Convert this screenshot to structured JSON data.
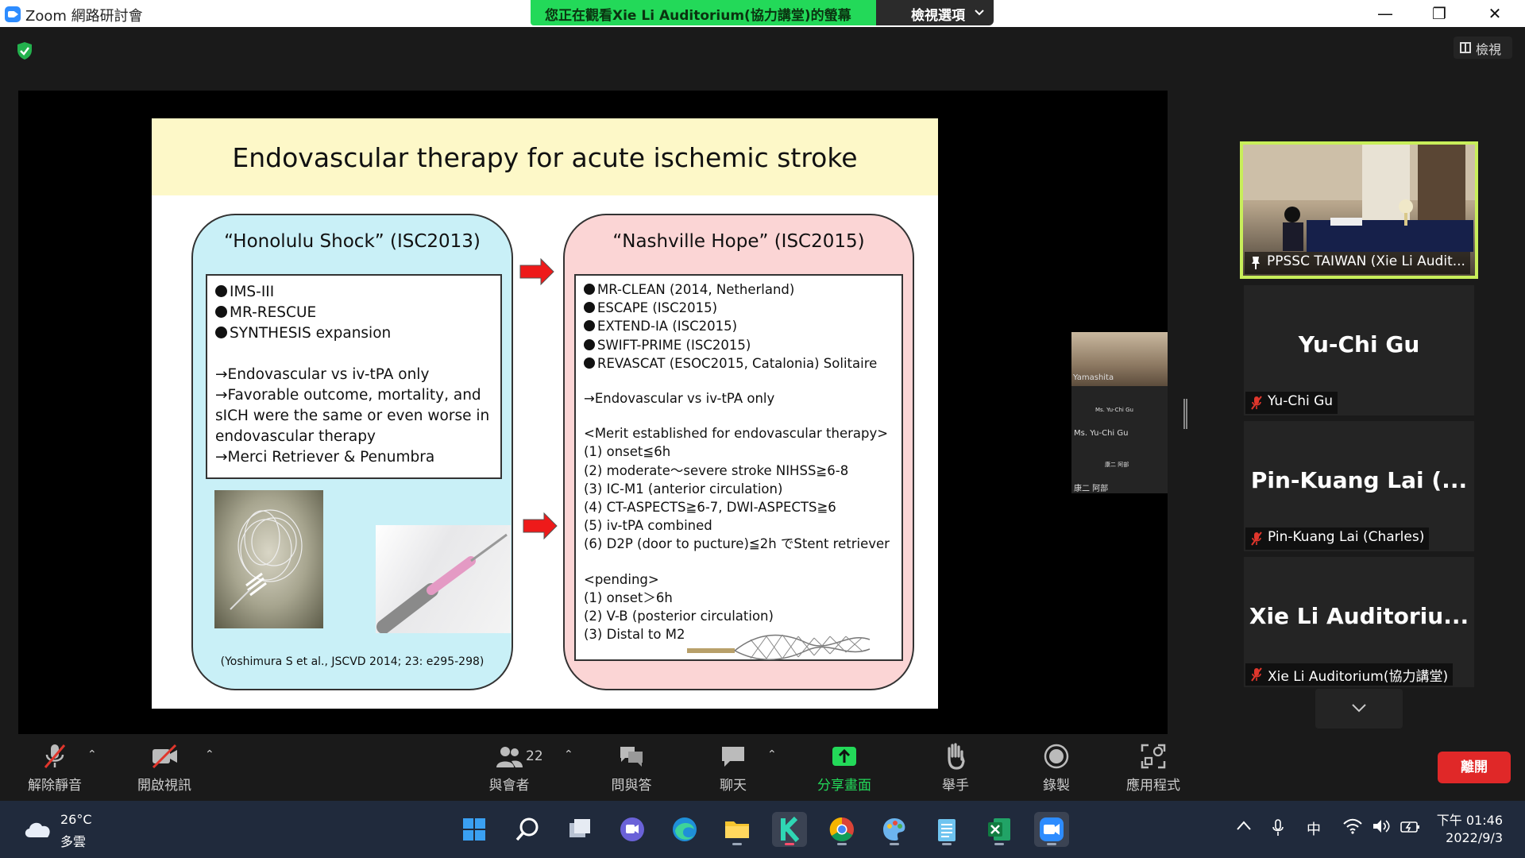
{
  "window": {
    "app_title": "Zoom 網路研討會",
    "viewing_banner": "您正在觀看Xie Li Auditorium(協力講堂)的螢幕",
    "view_options": "檢視選項",
    "minimize": "—",
    "restore": "❐",
    "close": "✕"
  },
  "meeting": {
    "view_button": "檢視"
  },
  "slide": {
    "title": "Endovascular therapy for acute ischemic stroke",
    "left": {
      "heading": "“Honolulu Shock” (ISC2013)",
      "trials": [
        "IMS-III",
        "MR-RESCUE",
        "SYNTHESIS expansion"
      ],
      "notes": [
        "→Endovascular vs iv-tPA only",
        "→Favorable outcome, mortality, and sICH were the same or even worse in endovascular therapy",
        "→Merci Retriever & Penumbra"
      ],
      "citation": "(Yoshimura S et al., JSCVD 2014; 23: e295-298)"
    },
    "right": {
      "heading": "“Nashville Hope” (ISC2015)",
      "trials": [
        "MR-CLEAN (2014, Netherland)",
        "ESCAPE (ISC2015)",
        "EXTEND-IA (ISC2015)",
        "SWIFT-PRIME (ISC2015)",
        "REVASCAT (ESOC2015, Catalonia) Solitaire"
      ],
      "note": "→Endovascular vs iv-tPA only",
      "merit_heading": "<Merit established for endovascular therapy>",
      "merits": [
        "(1) onset≦6h",
        "(2) moderate～severe stroke NIHSS≧6-8",
        "(3) IC-M1 (anterior circulation)",
        "(4) CT-ASPECTS≧6-7, DWI-ASPECTS≧6",
        "(5) iv-tPA combined",
        "(6) D2P (door to pucture)≦2h でStent retriever"
      ],
      "pending_heading": "<pending>",
      "pending": [
        "(1) onset＞6h",
        "(2) V-B (posterior circulation)",
        "(3) Distal to M2"
      ]
    }
  },
  "mini_strip": {
    "video_label": "Yamashita",
    "tiny_label_1": "Ms. Yu-Chi Gu",
    "label_2": "Ms. Yu-Chi Gu",
    "tiny_label_3": "康二 阿部",
    "label_4": "康二 阿部"
  },
  "participants": [
    {
      "name_tag": "PPSSC TAIWAN (Xie Li Audit...",
      "pinned": true
    },
    {
      "big_name": "Yu-Chi Gu",
      "name_tag": "Yu-Chi Gu"
    },
    {
      "big_name": "Pin-Kuang Lai (...",
      "name_tag": "Pin-Kuang Lai (Charles)"
    },
    {
      "big_name": "Xie Li Auditoriu...",
      "name_tag": "Xie Li Auditorium(協力講堂)"
    }
  ],
  "toolbar": {
    "unmute": "解除靜音",
    "start_video": "開啟視訊",
    "participants": "與會者",
    "participant_count": "22",
    "qa": "問與答",
    "chat": "聊天",
    "share_screen": "分享畫面",
    "raise_hand": "舉手",
    "record": "錄製",
    "apps": "應用程式",
    "leave": "離開"
  },
  "taskbar": {
    "temperature": "26°C",
    "weather": "多雲",
    "ime": "中",
    "time": "下午 01:46",
    "date": "2022/9/3"
  },
  "colors": {
    "banner_green": "#23d959",
    "share_icon_green": "#23d959",
    "pinned_border": "#c8ee5a",
    "leave_red": "#e02828",
    "muted_red": "#e0362c"
  }
}
